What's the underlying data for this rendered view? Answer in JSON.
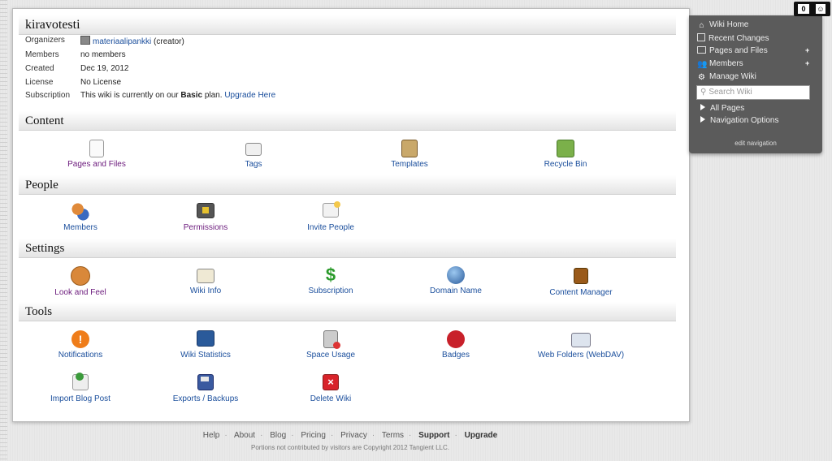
{
  "wiki": {
    "title": "kiravotesti",
    "organizers_label": "Organizers",
    "organizer_name": "materiaalipankki",
    "organizer_role": "(creator)",
    "members_label": "Members",
    "members_value": "no members",
    "created_label": "Created",
    "created_value": "Dec 19, 2012",
    "license_label": "License",
    "license_value": "No License",
    "subscription_label": "Subscription",
    "subscription_prefix": "This wiki is currently on our ",
    "subscription_plan": "Basic",
    "subscription_suffix": " plan. ",
    "upgrade_link": "Upgrade Here"
  },
  "sections": {
    "content": "Content",
    "people": "People",
    "settings": "Settings",
    "tools": "Tools"
  },
  "tools": {
    "pages_and_files": "Pages and Files",
    "tags": "Tags",
    "templates": "Templates",
    "recycle_bin": "Recycle Bin",
    "members": "Members",
    "permissions": "Permissions",
    "invite_people": "Invite People",
    "look_and_feel": "Look and Feel",
    "wiki_info": "Wiki Info",
    "subscription": "Subscription",
    "domain_name": "Domain Name",
    "content_manager": "Content Manager",
    "notifications": "Notifications",
    "wiki_statistics": "Wiki Statistics",
    "space_usage": "Space Usage",
    "badges": "Badges",
    "web_folders": "Web Folders (WebDAV)",
    "import_blog_post": "Import Blog Post",
    "exports_backups": "Exports / Backups",
    "delete_wiki": "Delete Wiki"
  },
  "sidebar": {
    "wiki_home": "Wiki Home",
    "recent_changes": "Recent Changes",
    "pages_and_files": "Pages and Files",
    "members": "Members",
    "manage_wiki": "Manage Wiki",
    "search_placeholder": "Search Wiki",
    "all_pages": "All Pages",
    "navigation_options": "Navigation Options",
    "edit_navigation": "edit navigation"
  },
  "topbar": {
    "count": "0"
  },
  "footer": {
    "help": "Help",
    "about": "About",
    "blog": "Blog",
    "pricing": "Pricing",
    "privacy": "Privacy",
    "terms": "Terms",
    "support": "Support",
    "upgrade": "Upgrade",
    "copyright": "Portions not contributed by visitors are Copyright 2012 Tangient LLC."
  },
  "colors": {
    "link_blue": "#1a4e9c",
    "visited_purple": "#6b1a7c",
    "sidebar_bg": "#5b5b5b"
  }
}
